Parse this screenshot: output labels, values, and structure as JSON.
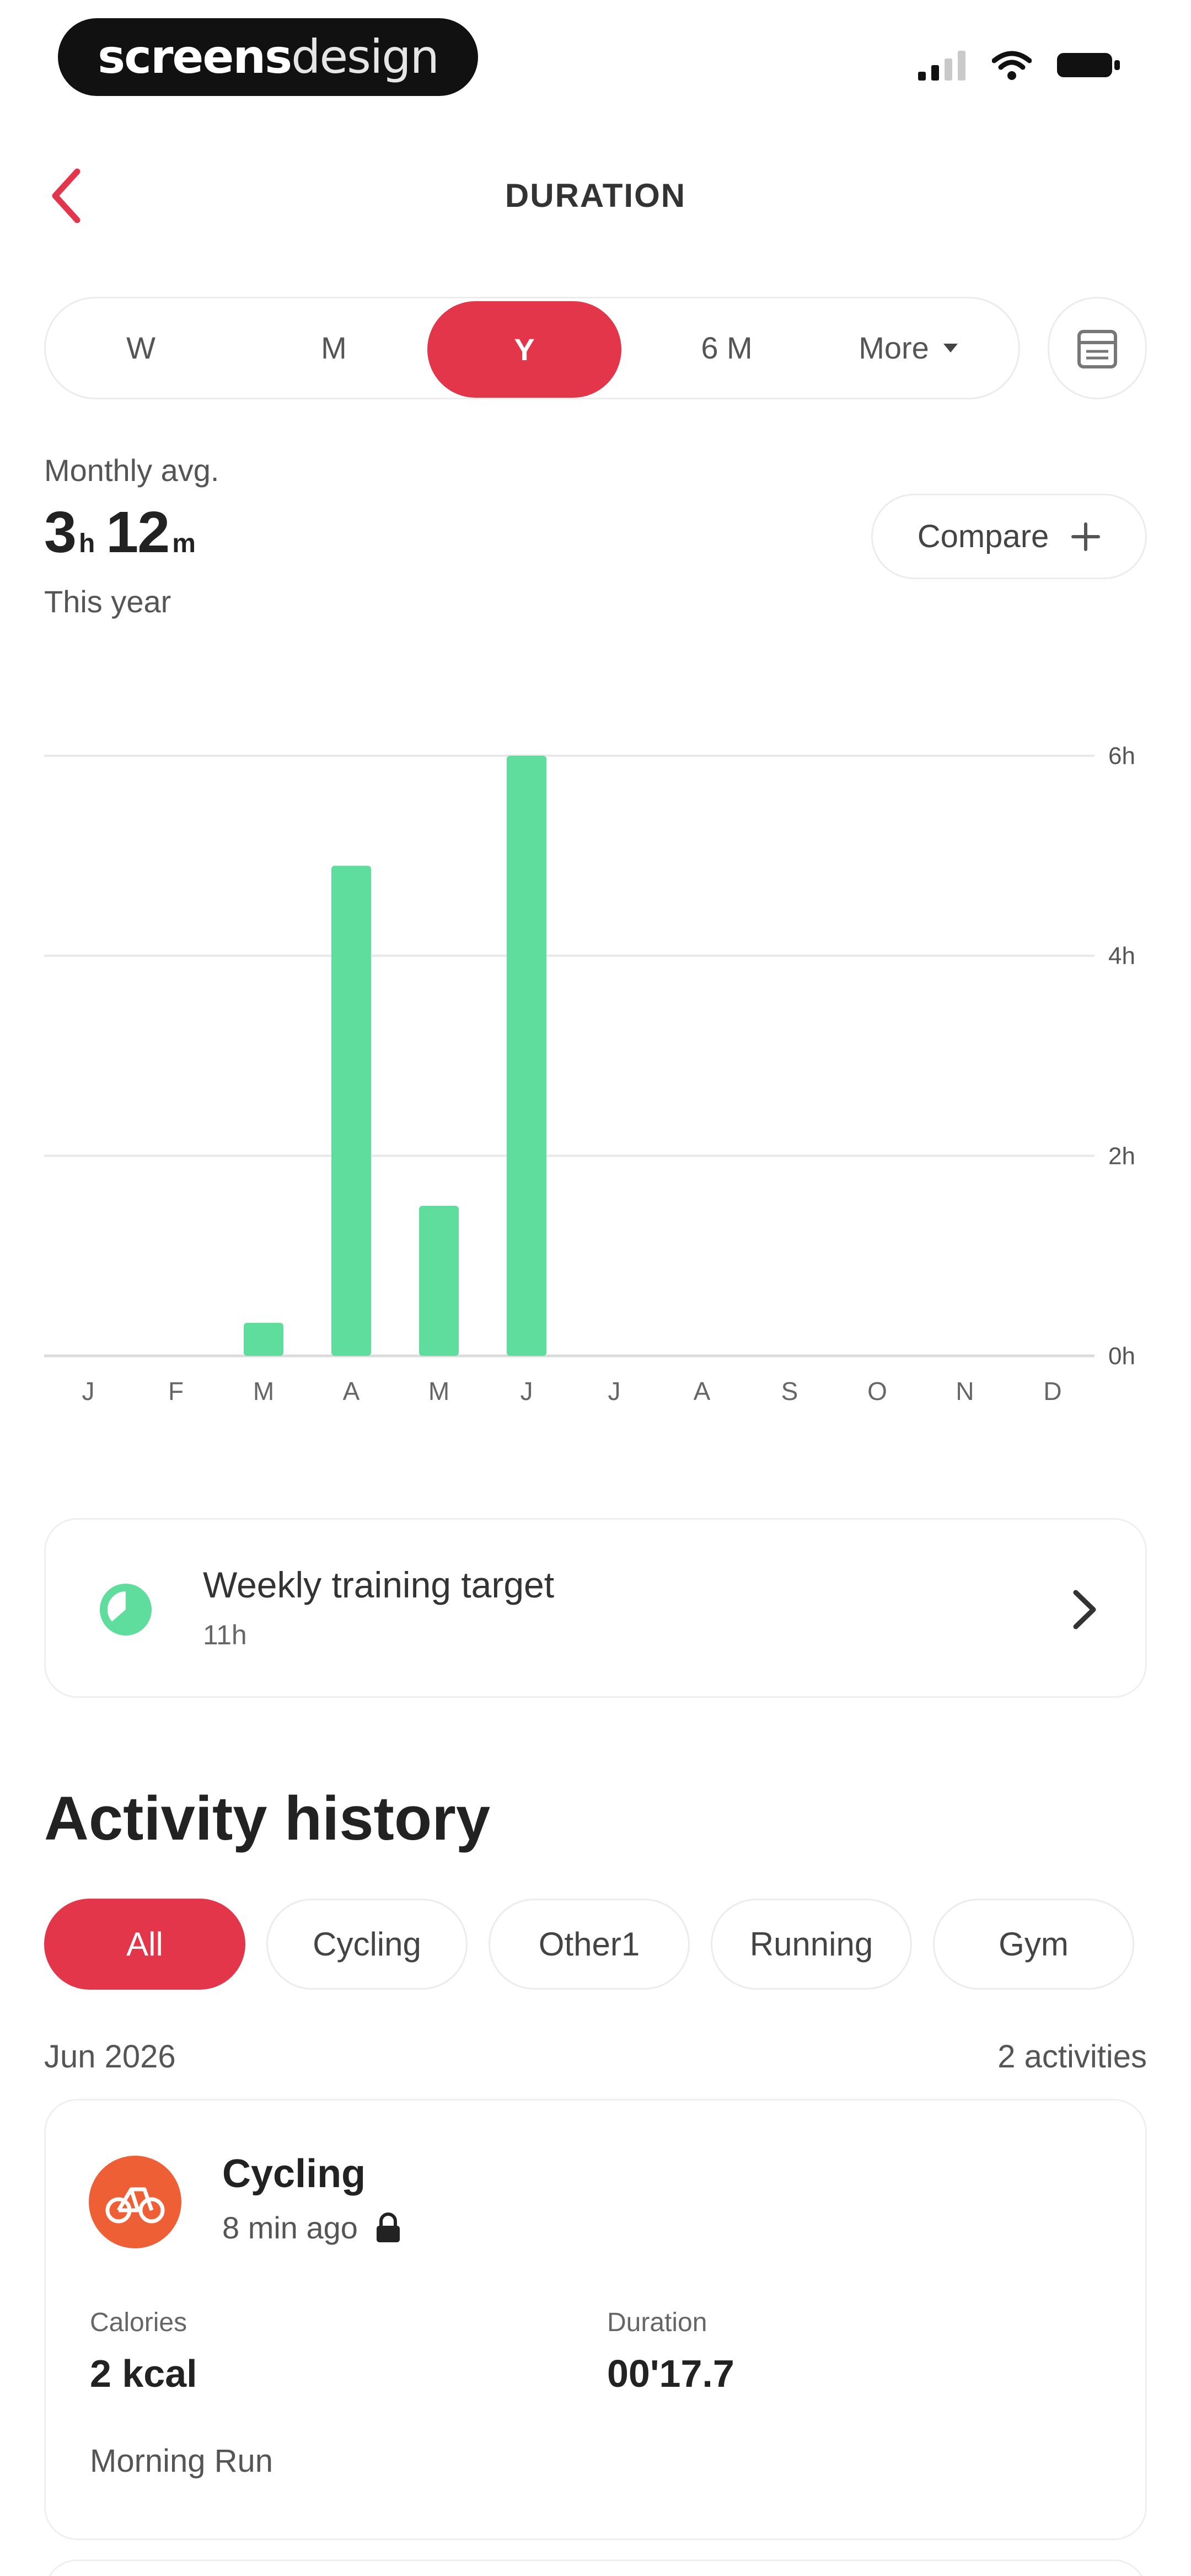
{
  "status_bar": {
    "brand_bold": "screens",
    "brand_light": "design"
  },
  "nav": {
    "title": "DURATION"
  },
  "period_tabs": [
    {
      "label": "W",
      "active": false
    },
    {
      "label": "M",
      "active": false
    },
    {
      "label": "Y",
      "active": true
    },
    {
      "label": "6 M",
      "active": false
    },
    {
      "label": "More",
      "active": false
    }
  ],
  "summary": {
    "label": "Monthly avg.",
    "hours": "3",
    "hours_unit": "h",
    "minutes": "12",
    "minutes_unit": "m",
    "sub": "This year",
    "compare_label": "Compare"
  },
  "chart_data": {
    "type": "bar",
    "categories": [
      "J",
      "F",
      "M",
      "A",
      "M",
      "J",
      "J",
      "A",
      "S",
      "O",
      "N",
      "D"
    ],
    "values": [
      0,
      0,
      0.33,
      4.9,
      1.5,
      6.0,
      0,
      0,
      0,
      0,
      0,
      0
    ],
    "ylim": [
      0,
      6
    ],
    "y_ticks": [
      "0h",
      "2h",
      "4h",
      "6h"
    ],
    "y_tick_values": [
      0,
      2,
      4,
      6
    ],
    "y_axis_side": "right",
    "grid": true,
    "bar_color": "#5fdd9d"
  },
  "weekly_target": {
    "title": "Weekly training target",
    "value": "11h"
  },
  "history": {
    "title": "Activity history",
    "filters": [
      {
        "label": "All",
        "active": true
      },
      {
        "label": "Cycling",
        "active": false
      },
      {
        "label": "Other1",
        "active": false
      },
      {
        "label": "Running",
        "active": false
      },
      {
        "label": "Gym",
        "active": false
      }
    ],
    "month": "Jun 2026",
    "count": "2 activities",
    "activities": [
      {
        "title": "Cycling",
        "time_ago": "8 min ago",
        "calories_label": "Calories",
        "calories_value": "2 kcal",
        "duration_label": "Duration",
        "duration_value": "00'17.7",
        "name": "Morning Run"
      }
    ]
  },
  "colors": {
    "accent": "#e3364a",
    "bar": "#5fdd9d",
    "activity_icon": "#ef5f35"
  }
}
